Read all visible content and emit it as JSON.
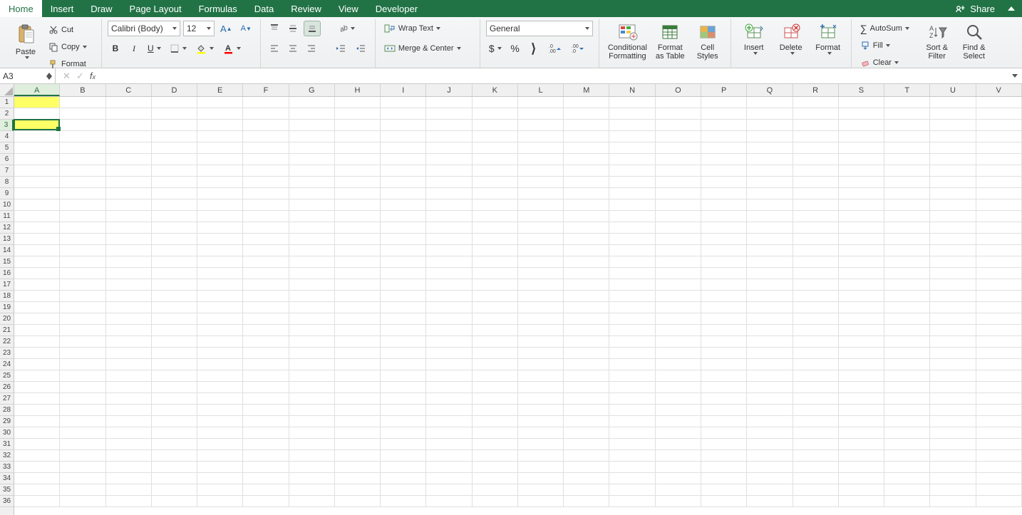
{
  "tabs": [
    "Home",
    "Insert",
    "Draw",
    "Page Layout",
    "Formulas",
    "Data",
    "Review",
    "View",
    "Developer"
  ],
  "active_tab": "Home",
  "share_label": "Share",
  "clipboard": {
    "paste": "Paste",
    "cut": "Cut",
    "copy": "Copy",
    "format_painter": "Format"
  },
  "font": {
    "name": "Calibri (Body)",
    "size": "12",
    "bold": "B",
    "italic": "I",
    "underline": "U"
  },
  "alignment": {
    "wrap_text": "Wrap Text",
    "merge_center": "Merge & Center"
  },
  "number": {
    "format": "General"
  },
  "styles": {
    "conditional": "Conditional\nFormatting",
    "format_table": "Format\nas Table",
    "cell_styles": "Cell\nStyles"
  },
  "cells": {
    "insert": "Insert",
    "delete": "Delete",
    "format": "Format"
  },
  "editing": {
    "autosum": "AutoSum",
    "fill": "Fill",
    "clear": "Clear",
    "sort_filter": "Sort &\nFilter",
    "find_select": "Find &\nSelect"
  },
  "name_box": "A3",
  "formula_value": "",
  "columns": [
    "A",
    "B",
    "C",
    "D",
    "E",
    "F",
    "G",
    "H",
    "I",
    "J",
    "K",
    "L",
    "M",
    "N",
    "O",
    "P",
    "Q",
    "R",
    "S",
    "T",
    "U",
    "V"
  ],
  "rows": 36,
  "selected_col": "A",
  "selected_row": 3,
  "highlighted_cells": [
    {
      "row": 1,
      "col": "A",
      "fill": "yellow"
    },
    {
      "row": 3,
      "col": "A",
      "fill": "yellow"
    }
  ],
  "active_cell": {
    "row": 3,
    "col": "A"
  }
}
